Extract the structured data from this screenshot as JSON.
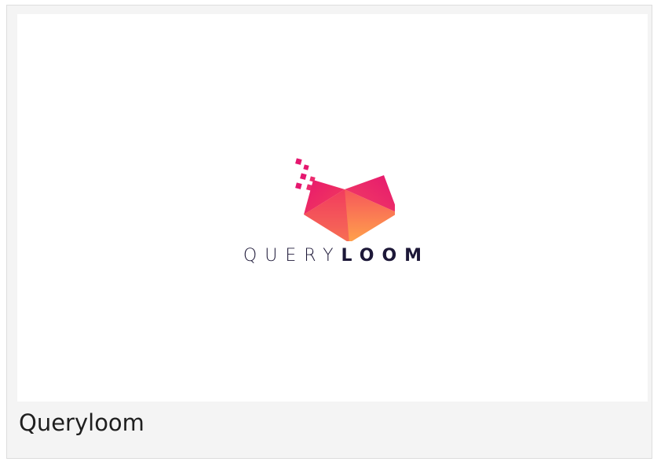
{
  "card": {
    "caption": "Queryloom",
    "logo": {
      "icon": "queryloom-logo-icon",
      "wordmark_light": "QUERY",
      "wordmark_bold": "LOOM",
      "colors": {
        "magenta": "#e5176f",
        "pink": "#f03a68",
        "orange": "#ffb14a",
        "text": "#1d1838"
      }
    }
  }
}
